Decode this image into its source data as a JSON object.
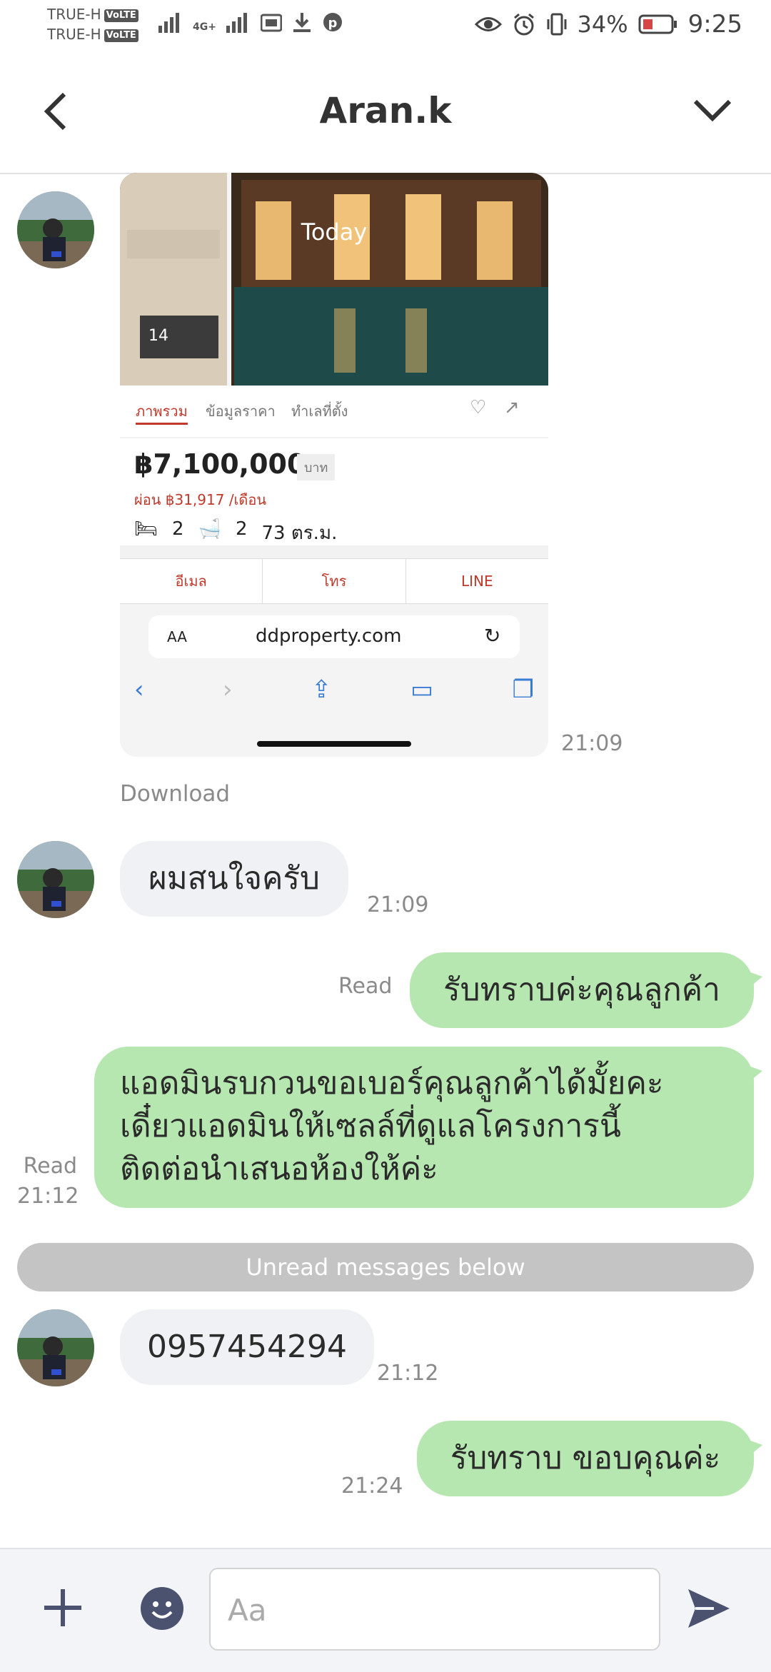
{
  "status_bar": {
    "carrier1": "TRUE-H",
    "carrier2": "TRUE-H",
    "volte": "VoLTE",
    "network": "4G+",
    "battery": "34%",
    "time": "9:25"
  },
  "header": {
    "title": "Aran.k"
  },
  "messages": {
    "image": {
      "date_label": "Today",
      "photo_count": "14",
      "tabs": [
        "ภาพรวม",
        "ข้อมูลราคา",
        "ทำเลที่ตั้ง"
      ],
      "price": "฿7,100,000",
      "price_unit": "บาท",
      "monthly": "ผ่อน ฿31,917 /เดือน",
      "beds": "2",
      "baths": "2",
      "area": "73 ตร.ม.",
      "actions": [
        "อีเมล",
        "โทร",
        "LINE"
      ],
      "text_size": "AA",
      "url": "ddproperty.com",
      "time": "21:09",
      "download": "Download"
    },
    "m1": {
      "text": "ผมสนใจครับ",
      "time": "21:09"
    },
    "m2": {
      "text": "รับทราบค่ะคุณลูกค้า",
      "read": "Read"
    },
    "m3": {
      "line1": "แอดมินรบกวนขอเบอร์คุณลูกค้าได้มั้ยคะ",
      "line2": "เดี๋ยวแอดมินให้เซลล์ที่ดูแลโครงการนี้",
      "line3": "ติดต่อนำเสนอห้องให้ค่ะ",
      "read": "Read",
      "time": "21:12"
    },
    "unread_divider": "Unread messages below",
    "m4": {
      "text": "0957454294",
      "time": "21:12"
    },
    "m5": {
      "text": "รับทราบ ขอบคุณค่ะ",
      "time": "21:24"
    }
  },
  "composer": {
    "placeholder": "Aa"
  },
  "colors": {
    "outgoing_bubble": "#b7e7b0",
    "incoming_bubble": "#f0f1f4",
    "icon": "#4a5270"
  }
}
